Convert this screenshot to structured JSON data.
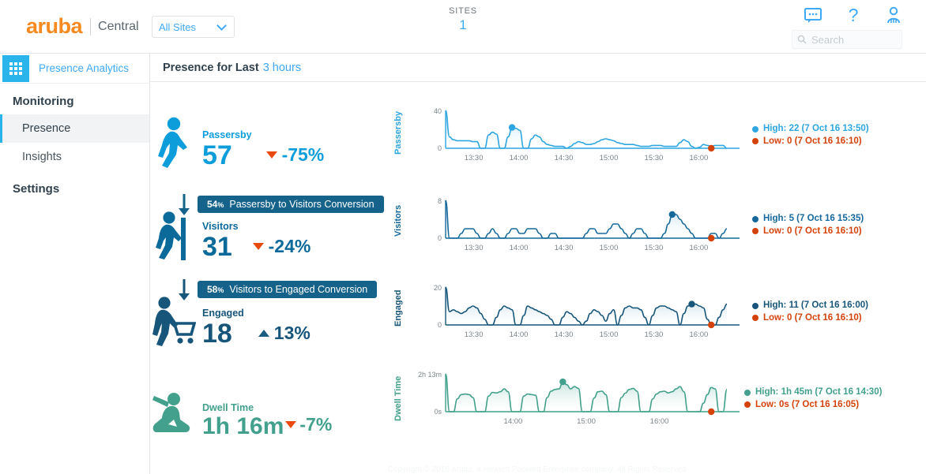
{
  "header": {
    "brand_logo": "aruba",
    "brand_sub": "Central",
    "site_selector": {
      "value": "All Sites",
      "chevron_icon": "chevron-down-icon"
    },
    "sites_label": "SITES",
    "sites_count": "1",
    "icons": [
      "feedback-icon",
      "help-icon",
      "user-icon"
    ],
    "search": {
      "placeholder": "Search",
      "icon": "search-icon"
    }
  },
  "sidebar": {
    "app_launcher_icon": "grid-apps-icon",
    "app_name": "Presence Analytics",
    "sections": [
      {
        "title": "Monitoring",
        "items": [
          "Presence",
          "Insights"
        ]
      },
      {
        "title": "Settings",
        "items": []
      }
    ],
    "active_item": "Presence"
  },
  "page": {
    "title": "Presence for Last",
    "title_accent": "3 hours"
  },
  "metrics": [
    {
      "key": "passersby",
      "icon": "walking-person-icon",
      "label": "Passersby",
      "value": "57",
      "delta": "-75%",
      "delta_dir": "down",
      "color": "#0D9DDB",
      "value_color": "#0D9DDB",
      "delta_color": "#0D9DDB"
    },
    {
      "key": "visitors",
      "icon": "person-entering-door-icon",
      "label": "Visitors",
      "value": "31",
      "delta": "-24%",
      "delta_dir": "down",
      "color": "#0C6A9B",
      "value_color": "#0C6A9B",
      "delta_color": "#0C6A9B"
    },
    {
      "key": "engaged",
      "icon": "person-shopping-cart-icon",
      "label": "Engaged",
      "value": "18",
      "delta": "13%",
      "delta_dir": "up",
      "color": "#17567A",
      "value_color": "#17567A",
      "delta_color": "#17567A"
    },
    {
      "key": "dwell_time",
      "icon": "person-sitting-icon",
      "label": "Dwell Time",
      "value": "1h 16m",
      "delta": "-7%",
      "delta_dir": "down",
      "color": "#42A08C",
      "value_color": "#42A08C",
      "delta_color": "#42A08C"
    }
  ],
  "conversions": [
    {
      "key": "passersby-to-visitors",
      "arrow_icon": "arrow-down-icon",
      "percent": "54",
      "percent_unit": "%",
      "text": "Passersby to Visitors Conversion"
    },
    {
      "key": "visitors-to-engaged",
      "arrow_icon": "arrow-down-icon",
      "percent": "58",
      "percent_unit": "%",
      "text": "Visitors to Engaged Conversion"
    }
  ],
  "chart_data": [
    {
      "type": "area",
      "key": "passersby-chart",
      "title": "Passersby",
      "ylabel": "Passersby",
      "xlabel": "",
      "ytick_top": "40",
      "ytick_bottom": "0",
      "ylim": [
        0,
        40
      ],
      "xticks": [
        "13:30",
        "14:00",
        "14:30",
        "15:00",
        "15:30",
        "16:00"
      ],
      "line_color": "#2EA6E0",
      "fill_top": "#9FD6F2",
      "fill_bottom": "#FFFFFF",
      "high": {
        "label": "High: 22 (7 Oct 16 13:50)",
        "value": 22,
        "time": "7 Oct 16 13:50",
        "color": "#2EA6E0"
      },
      "low": {
        "label": "Low: 0 (7 Oct 16 16:10)",
        "value": 0,
        "time": "7 Oct 16 16:10",
        "color": "#D4420A"
      },
      "x": [
        0,
        1,
        2,
        3,
        4,
        5,
        6,
        7,
        8,
        9,
        10,
        11,
        12,
        13,
        14,
        15,
        16,
        17,
        18,
        19,
        20,
        21,
        22,
        23,
        24,
        25,
        26,
        27,
        28,
        29,
        30,
        31,
        32,
        33,
        34,
        35,
        36,
        37,
        38,
        39,
        40,
        41,
        42,
        43,
        44,
        45,
        46,
        47,
        48,
        49,
        50,
        51,
        52,
        53,
        54,
        55,
        56,
        57,
        58,
        59,
        60,
        61,
        62,
        63,
        64,
        65,
        66,
        67,
        68,
        69,
        70,
        71,
        72
      ],
      "values": [
        40,
        12,
        9,
        8,
        8,
        8,
        8,
        7,
        7,
        0,
        0,
        14,
        17,
        15,
        0,
        0,
        12,
        22,
        21,
        19,
        0,
        0,
        10,
        14,
        12,
        7,
        4,
        3,
        2,
        2,
        2,
        0,
        2,
        5,
        7,
        6,
        4,
        4,
        5,
        7,
        9,
        10,
        9,
        8,
        6,
        5,
        4,
        4,
        4,
        3,
        2,
        2,
        2,
        3,
        3,
        3,
        2,
        2,
        2,
        2,
        6,
        9,
        7,
        2,
        0,
        1,
        4,
        3,
        2,
        3,
        3,
        3,
        0
      ]
    },
    {
      "type": "area",
      "key": "visitors-chart",
      "title": "Visitors",
      "ylabel": "Visitors",
      "xlabel": "",
      "ytick_top": "8",
      "ytick_bottom": "0",
      "ylim": [
        0,
        8
      ],
      "xticks": [
        "13:30",
        "14:00",
        "14:30",
        "15:00",
        "15:30",
        "16:00"
      ],
      "line_color": "#16689B",
      "fill_top": "#A7CFE4",
      "fill_bottom": "#FFFFFF",
      "high": {
        "label": "High: 5 (7 Oct 16 15:35)",
        "value": 5,
        "time": "7 Oct 16 15:35",
        "color": "#16689B"
      },
      "low": {
        "label": "Low: 0 (7 Oct 16 16:10)",
        "value": 0,
        "time": "7 Oct 16 16:10",
        "color": "#D4420A"
      },
      "x": [
        0,
        1,
        2,
        3,
        4,
        5,
        6,
        7,
        8,
        9,
        10,
        11,
        12,
        13,
        14,
        15,
        16,
        17,
        18,
        19,
        20,
        21,
        22,
        23,
        24,
        25,
        26,
        27,
        28,
        29,
        30,
        31,
        32,
        33,
        34,
        35,
        36,
        37,
        38,
        39,
        40,
        41,
        42,
        43,
        44,
        45,
        46,
        47,
        48,
        49,
        50,
        51,
        52,
        53,
        54,
        55,
        56,
        57,
        58,
        59,
        60,
        61,
        62,
        63,
        64,
        65,
        66,
        67,
        68,
        69,
        70,
        71,
        72
      ],
      "values": [
        8,
        0,
        0,
        0,
        1,
        2,
        2,
        2,
        1,
        0,
        0,
        1,
        2,
        1,
        0,
        0,
        1,
        2,
        2,
        1,
        1,
        2,
        2,
        2,
        1,
        0,
        0,
        1,
        1,
        0,
        0,
        0,
        0,
        0,
        0,
        0,
        1,
        2,
        2,
        1,
        1,
        1,
        2,
        3,
        3,
        2,
        1,
        0,
        1,
        2,
        2,
        1,
        0,
        0,
        0,
        0,
        1,
        3,
        5,
        5,
        4,
        3,
        2,
        1,
        0,
        0,
        0,
        0,
        1,
        1,
        0,
        1,
        2
      ]
    },
    {
      "type": "area",
      "key": "engaged-chart",
      "title": "Engaged",
      "ylabel": "Engaged",
      "xlabel": "",
      "ytick_top": "20",
      "ytick_bottom": "0",
      "ylim": [
        0,
        20
      ],
      "xticks": [
        "13:30",
        "14:00",
        "14:30",
        "15:00",
        "15:30",
        "16:00"
      ],
      "line_color": "#17567A",
      "fill_top": "#8FB8CE",
      "fill_bottom": "#FFFFFF",
      "high": {
        "label": "High: 11 (7 Oct 16 16:00)",
        "value": 11,
        "time": "7 Oct 16 16:00",
        "color": "#17567A"
      },
      "low": {
        "label": "Low: 0 (7 Oct 16 16:10)",
        "value": 0,
        "time": "7 Oct 16 16:10",
        "color": "#D4420A"
      },
      "x": [
        0,
        1,
        2,
        3,
        4,
        5,
        6,
        7,
        8,
        9,
        10,
        11,
        12,
        13,
        14,
        15,
        16,
        17,
        18,
        19,
        20,
        21,
        22,
        23,
        24,
        25,
        26,
        27,
        28,
        29,
        30,
        31,
        32,
        33,
        34,
        35,
        36,
        37,
        38,
        39,
        40,
        41,
        42,
        43,
        44,
        45,
        46,
        47,
        48,
        49,
        50,
        51,
        52,
        53,
        54,
        55,
        56,
        57,
        58,
        59,
        60,
        61,
        62,
        63,
        64,
        65,
        66,
        67,
        68,
        69,
        70,
        71,
        72
      ],
      "values": [
        20,
        7,
        8,
        7,
        6,
        7,
        9,
        10,
        9,
        6,
        3,
        0,
        0,
        4,
        8,
        10,
        9,
        8,
        0,
        0,
        5,
        10,
        9,
        8,
        7,
        6,
        5,
        3,
        0,
        0,
        4,
        7,
        6,
        4,
        2,
        0,
        2,
        6,
        8,
        7,
        5,
        2,
        6,
        8,
        0,
        5,
        9,
        10,
        9,
        9,
        8,
        4,
        0,
        5,
        9,
        10,
        10,
        9,
        8,
        7,
        0,
        6,
        10,
        11,
        11,
        10,
        9,
        3,
        0,
        0,
        4,
        8,
        11
      ]
    },
    {
      "type": "area",
      "key": "dwell-time-chart",
      "title": "Dwell Time",
      "ylabel": "Dwell Time",
      "xlabel": "",
      "ytick_top": "2h 13m",
      "ytick_bottom": "0s",
      "ylim": [
        0,
        133
      ],
      "xticks": [
        "14:00",
        "15:00",
        "16:00"
      ],
      "line_color": "#42A08C",
      "fill_top": "#9ED2C6",
      "fill_bottom": "#FFFFFF",
      "high": {
        "label": "High: 1h 45m (7 Oct 16 14:30)",
        "value": 105,
        "time": "7 Oct 16 14:30",
        "color": "#42A08C"
      },
      "low": {
        "label": "Low: 0s (7 Oct 16 16:05)",
        "value": 0,
        "time": "7 Oct 16 16:05",
        "color": "#D4420A"
      },
      "x": [
        0,
        1,
        2,
        3,
        4,
        5,
        6,
        7,
        8,
        9,
        10,
        11,
        12,
        13,
        14,
        15,
        16,
        17,
        18,
        19,
        20,
        21,
        22,
        23,
        24,
        25,
        26,
        27,
        28,
        29,
        30,
        31,
        32,
        33,
        34,
        35,
        36,
        37,
        38,
        39,
        40,
        41,
        42,
        43,
        44,
        45,
        46,
        47,
        48,
        49,
        50,
        51,
        52,
        53,
        54,
        55,
        56,
        57,
        58,
        59,
        60,
        61,
        62,
        63,
        64,
        65,
        66,
        67,
        68,
        69,
        70,
        71,
        72
      ],
      "values": [
        133,
        0,
        0,
        45,
        60,
        62,
        60,
        50,
        0,
        0,
        0,
        55,
        68,
        66,
        70,
        80,
        70,
        0,
        0,
        0,
        55,
        62,
        60,
        58,
        0,
        0,
        50,
        72,
        78,
        80,
        105,
        95,
        80,
        88,
        82,
        0,
        0,
        0,
        48,
        70,
        72,
        60,
        0,
        0,
        0,
        50,
        65,
        78,
        82,
        72,
        0,
        0,
        0,
        45,
        62,
        70,
        72,
        66,
        70,
        80,
        88,
        70,
        0,
        0,
        0,
        0,
        30,
        60,
        85,
        80,
        0,
        0,
        78
      ]
    }
  ],
  "footer": {
    "text": "Copyright © 2016 Aruba, a Hewlett Packard Enterprise company. All Rights Reserved."
  }
}
